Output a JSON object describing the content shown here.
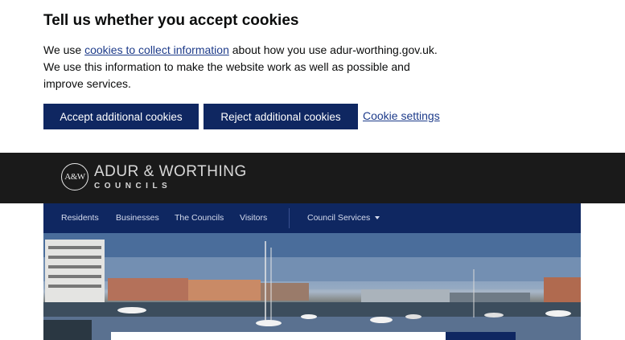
{
  "cookie_banner": {
    "title": "Tell us whether you accept cookies",
    "text_before_link": "We use ",
    "link_text": "cookies to collect information",
    "text_after_link": " about how you use adur-worthing.gov.uk. We use this information to make the website work as well as possible and improve services.",
    "accept_label": "Accept additional cookies",
    "reject_label": "Reject additional cookies",
    "settings_label": "Cookie settings"
  },
  "header": {
    "logo_mark": "A&W",
    "logo_name": "ADUR & WORTHING",
    "logo_sub": "COUNCILS"
  },
  "nav": {
    "items": [
      {
        "label": "Residents"
      },
      {
        "label": "Businesses"
      },
      {
        "label": "The Councils"
      },
      {
        "label": "Visitors"
      }
    ],
    "services_label": "Council Services"
  },
  "colors": {
    "navy": "#0f2761",
    "header_bg": "#1a1a1a",
    "link": "#1d3b8a"
  }
}
